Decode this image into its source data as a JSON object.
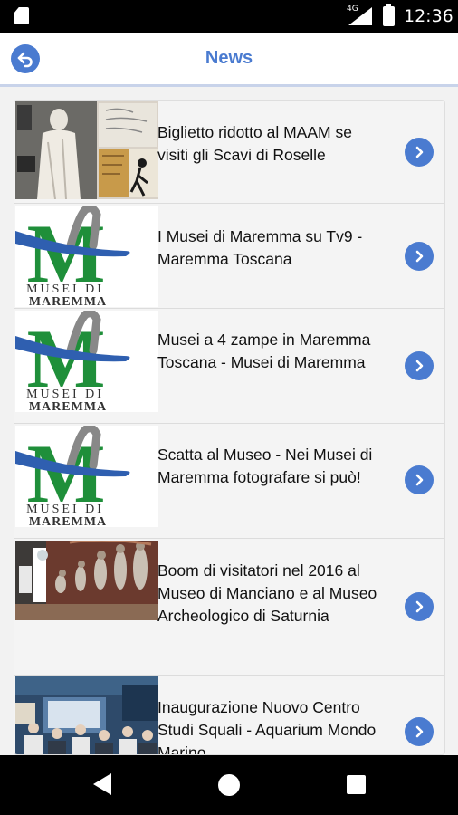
{
  "status_bar": {
    "time": "12:36",
    "network": "4G"
  },
  "header": {
    "title": "News"
  },
  "logo": {
    "line1": "MUSEI DI",
    "line2": "MAREMMA",
    "letter": "M"
  },
  "news": [
    {
      "title": "Biglietto ridotto al MAAM se visiti gli Scavi di Roselle",
      "thumb": "museum-poster"
    },
    {
      "title": "I Musei di Maremma su Tv9 - Maremma Toscana",
      "thumb": "musei-logo"
    },
    {
      "title": "Musei a 4 zampe in Maremma Toscana - Musei di Maremma",
      "thumb": "musei-logo"
    },
    {
      "title": "Scatta al Museo - Nei Musei di Maremma fotografare si può!",
      "thumb": "musei-logo"
    },
    {
      "title": "Boom di visitatori nel 2016 al Museo di Manciano e al Museo Archeologico di Saturnia",
      "thumb": "evolution-exhibit"
    },
    {
      "title": "Inaugurazione Nuovo Centro Studi Squali - Aquarium Mondo Marino",
      "thumb": "aquarium-crowd"
    }
  ],
  "colors": {
    "accent": "#4a7bd0",
    "logo_green": "#1f8f3a",
    "logo_blue": "#2f5fb0"
  }
}
